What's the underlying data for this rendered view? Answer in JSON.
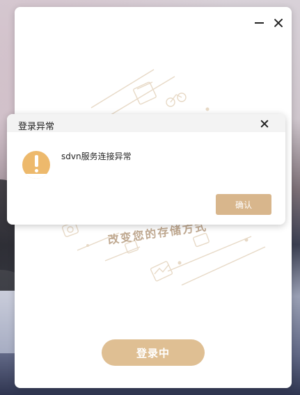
{
  "dialog": {
    "title": "登录异常",
    "message": "sdvn服务连接异常",
    "confirm_label": "确认",
    "icon": "warning-icon"
  },
  "main": {
    "slogan": "改变您的存储方式",
    "login_button_label": "登录中"
  },
  "window_controls": {
    "minimize_icon": "minimize-icon",
    "close_icon": "close-icon"
  },
  "colors": {
    "accent": "#dfbf93",
    "warning": "#edb96c",
    "illustration": "#e7d9c6"
  }
}
